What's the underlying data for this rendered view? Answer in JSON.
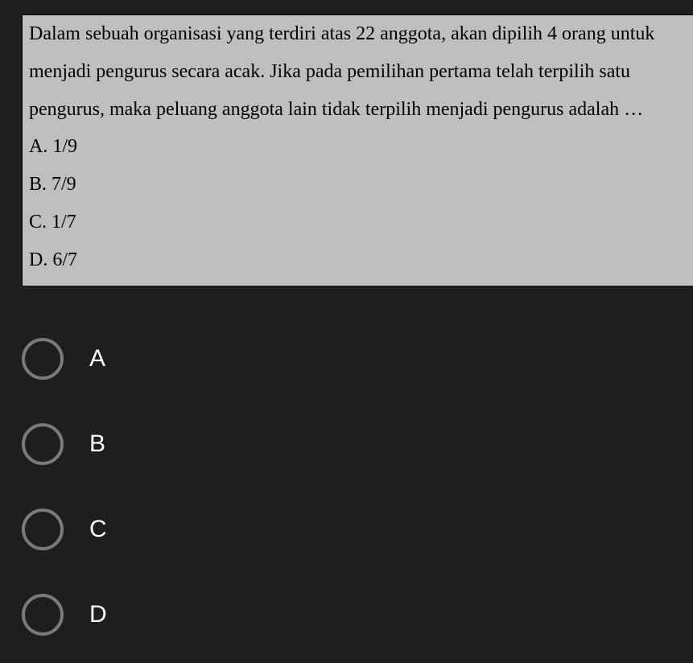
{
  "question": {
    "stem": "Dalam sebuah organisasi yang terdiri atas 22 anggota, akan dipilih 4 orang untuk menjadi pengurus secara acak. Jika pada pemilihan pertama telah terpilih satu pengurus, maka peluang anggota lain tidak terpilih menjadi pengurus adalah …",
    "options": {
      "A": "A. 1/9",
      "B": "B. 7/9",
      "C": "C. 1/7",
      "D": "D. 6/7"
    }
  },
  "answers": {
    "A": "A",
    "B": "B",
    "C": "C",
    "D": "D"
  }
}
